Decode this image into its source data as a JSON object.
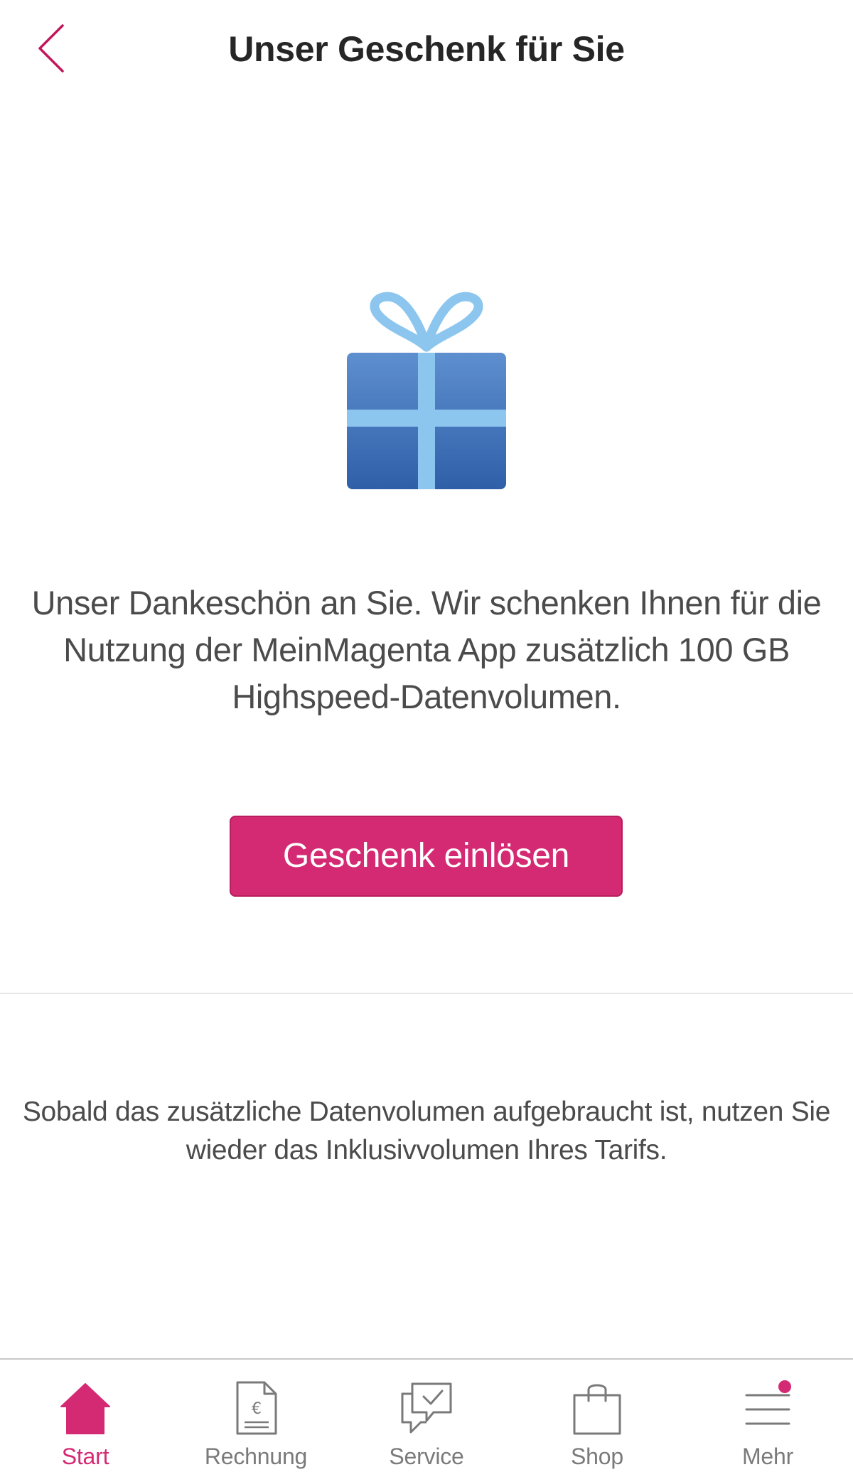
{
  "header": {
    "title": "Unser Geschenk für Sie",
    "back_icon": "chevron-left-icon"
  },
  "content": {
    "gift_icon": "gift-icon",
    "intro_text": "Unser Dankeschön an Sie. Wir schenken Ihnen für die Nutzung der MeinMagenta App zusätzlich 100 GB Highspeed-Datenvolumen.",
    "redeem_button": "Geschenk einlösen",
    "note_text": "Sobald das zusätzliche Datenvolumen aufgebraucht ist, nutzen Sie wieder das Inklusivvolumen Ihres Tarifs."
  },
  "nav": {
    "items": [
      {
        "label": "Start",
        "icon": "home-icon",
        "active": true
      },
      {
        "label": "Rechnung",
        "icon": "invoice-icon",
        "active": false
      },
      {
        "label": "Service",
        "icon": "service-chat-icon",
        "active": false
      },
      {
        "label": "Shop",
        "icon": "shopping-bag-icon",
        "active": false
      },
      {
        "label": "Mehr",
        "icon": "menu-icon",
        "active": false
      }
    ]
  },
  "colors": {
    "brand_magenta": "#d42a73",
    "gift_blue": "#3f72b8",
    "gift_ribbon": "#8cc6ef"
  }
}
